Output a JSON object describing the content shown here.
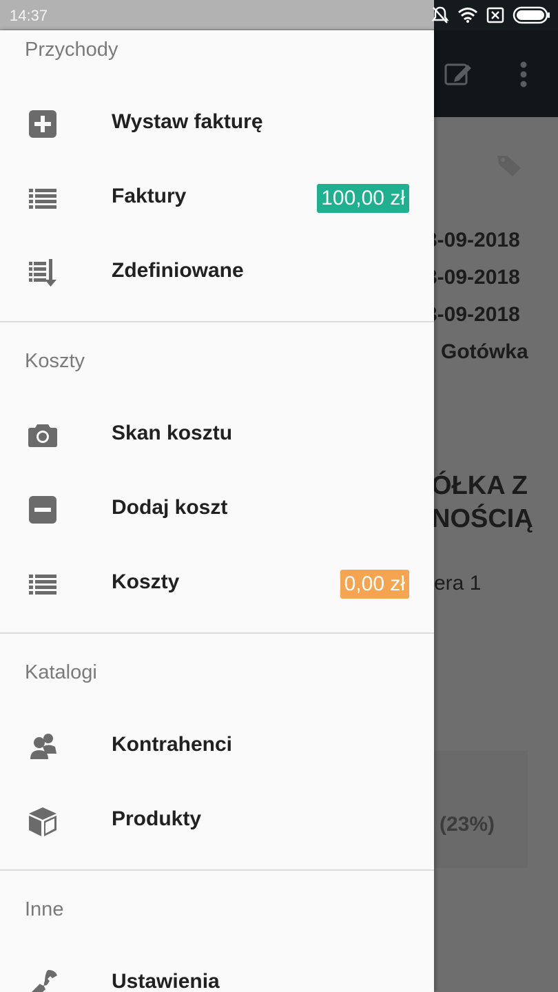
{
  "status_bar": {
    "time": "14:37"
  },
  "background": {
    "dates": [
      "3-09-2018",
      "3-09-2018",
      "3-09-2018"
    ],
    "payment": "Gotówka",
    "company_line1": "ÓŁKA Z",
    "company_line2": "NOŚCIĄ",
    "page_text": "era 1",
    "tax_rate": "(23%)"
  },
  "drawer": {
    "sections": {
      "income": {
        "title": "Przychody"
      },
      "costs": {
        "title": "Koszty"
      },
      "catalogs": {
        "title": "Katalogi"
      },
      "other": {
        "title": "Inne"
      }
    },
    "items": {
      "issue_invoice": "Wystaw fakturę",
      "invoices": "Faktury",
      "invoices_badge": "100,00 zł",
      "predefined": "Zdefiniowane",
      "scan_cost": "Skan kosztu",
      "add_cost": "Dodaj koszt",
      "costs": "Koszty",
      "costs_badge": "0,00 zł",
      "contractors": "Kontrahenci",
      "products": "Produkty",
      "settings": "Ustawienia"
    },
    "colors": {
      "income_badge": "#1fb08f",
      "cost_badge": "#f5a552",
      "icon": "#6b6b6b"
    },
    "icons": {
      "issue_invoice": "plus-square-icon",
      "invoices": "list-icon",
      "predefined": "list-arrow-down-icon",
      "scan_cost": "camera-icon",
      "add_cost": "minus-square-icon",
      "costs": "list-icon",
      "contractors": "users-icon",
      "products": "cube-icon",
      "settings": "wrench-icon"
    }
  }
}
